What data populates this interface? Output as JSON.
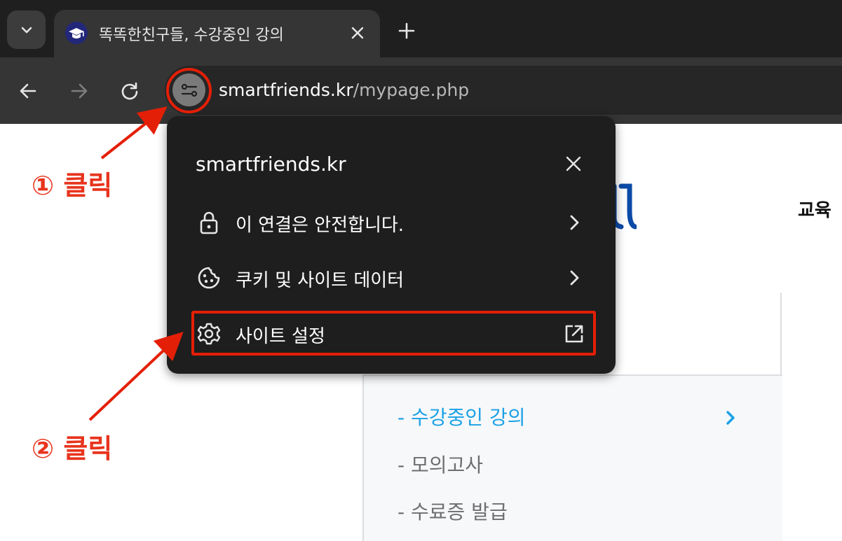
{
  "browser": {
    "tab": {
      "title": "똑똑한친구들, 수강중인 강의",
      "favicon": "graduation-cap-icon"
    },
    "url": {
      "domain": "smartfriends.kr",
      "path": "/mypage.php"
    }
  },
  "popup": {
    "title": "smartfriends.kr",
    "rows": [
      {
        "label": "이 연결은 안전합니다.",
        "icon": "lock-icon"
      },
      {
        "label": "쿠키 및 사이트 데이터",
        "icon": "cookie-icon"
      },
      {
        "label": "사이트 설정",
        "icon": "gear-icon"
      }
    ]
  },
  "page": {
    "heading_fragment": "교육",
    "side_menu": [
      {
        "label": "- 수강중인 강의",
        "active": true
      },
      {
        "label": "- 모의고사",
        "active": false
      },
      {
        "label": "- 수료증 발급",
        "active": false
      }
    ]
  },
  "annotations": {
    "step1": "① 클릭",
    "step2": "② 클릭",
    "color": "#e41f07"
  },
  "colors": {
    "active_menu": "#1aa1e6",
    "brand_blue": "#0b4aa6"
  }
}
